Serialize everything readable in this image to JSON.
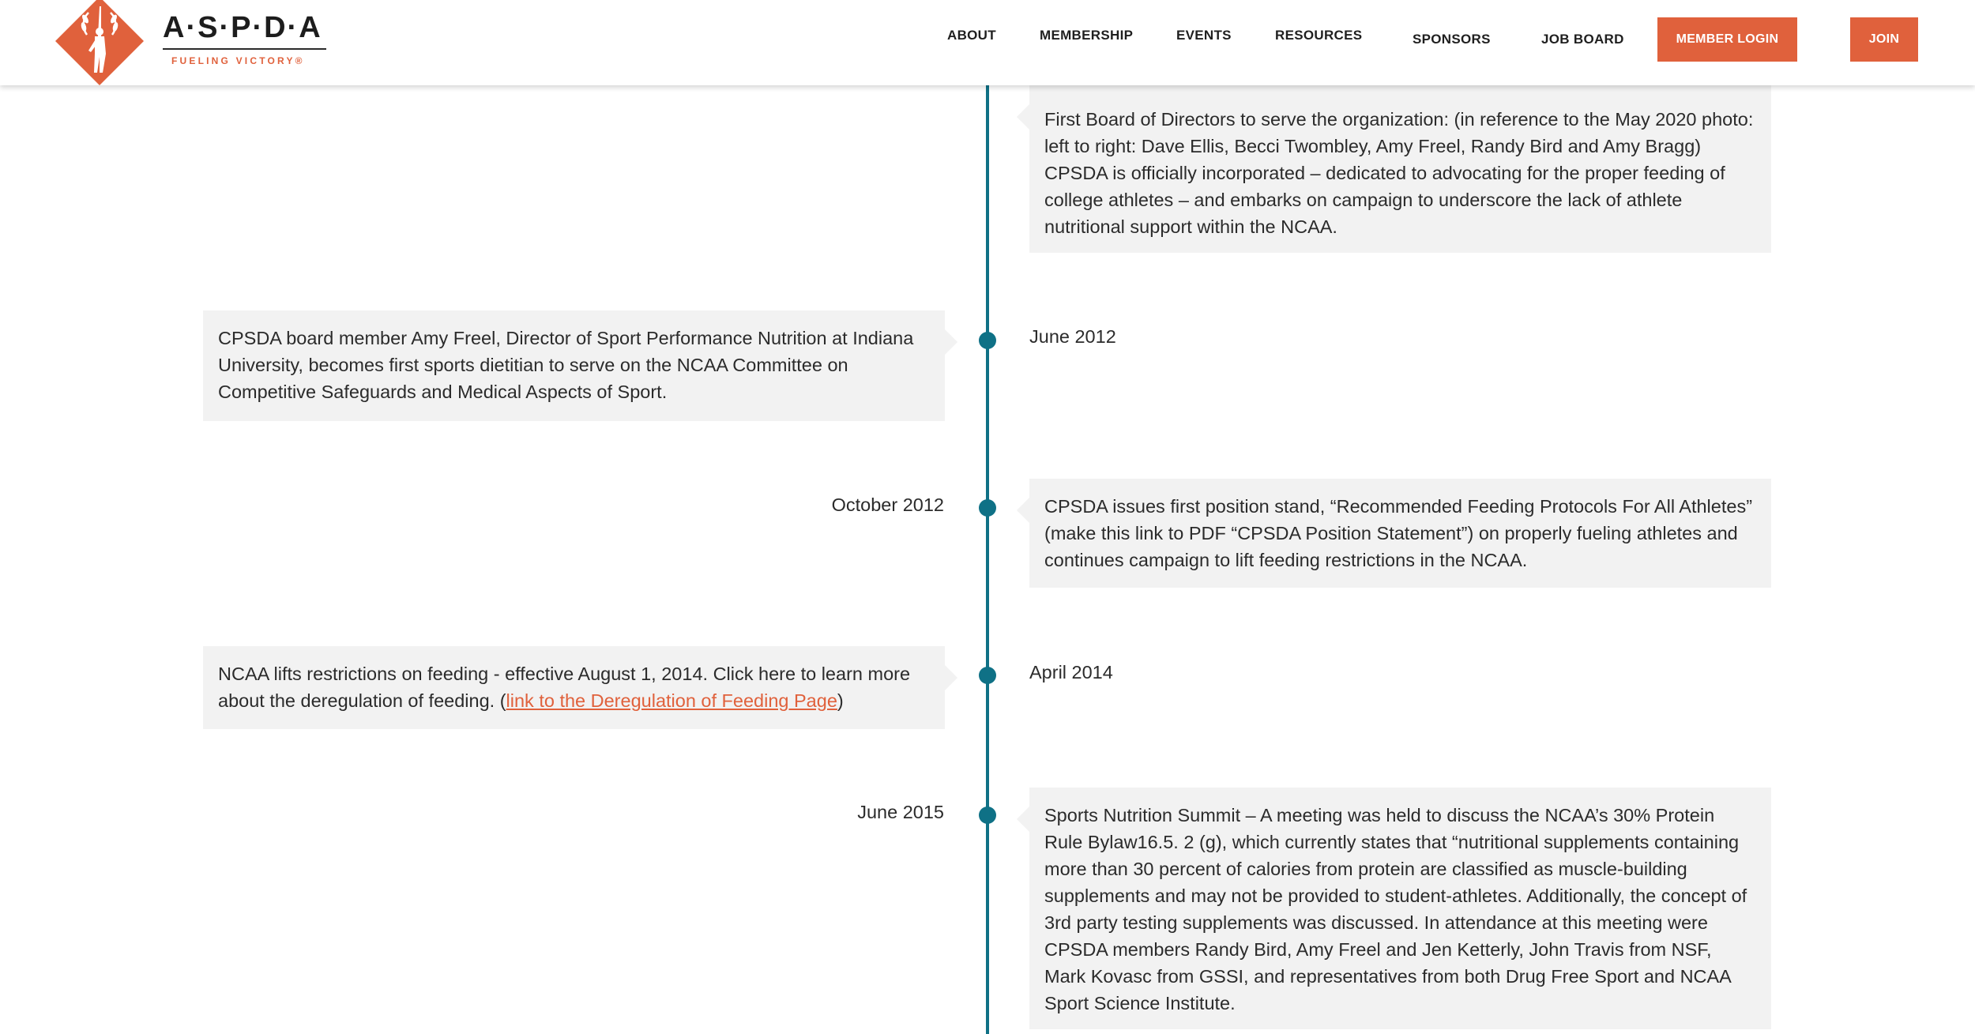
{
  "brand": {
    "name": "A·S·P·D·A",
    "tagline": "FUELING VICTORY®",
    "accent_color": "#e0613c",
    "timeline_color": "#0f7186"
  },
  "nav": {
    "about": "ABOUT",
    "membership": "MEMBERSHIP",
    "events": "EVENTS",
    "resources": "RESOURCES",
    "sponsors": "SPONSORS",
    "job_board": "JOB BOARD",
    "member_login": "MEMBER LOGIN",
    "join": "JOIN"
  },
  "timeline": {
    "entry0": {
      "text": "First Board of Directors to serve the organization: (in reference to the May 2020 photo: left to right: Dave Ellis, Becci Twombley, Amy Freel, Randy Bird and Amy Bragg) CPSDA is officially incorporated – dedicated to advocating for the proper feeding of college athletes – and embarks on campaign to underscore the lack of athlete nutritional support within the NCAA."
    },
    "entry1": {
      "date": "June 2012",
      "text": "CPSDA board member Amy Freel, Director of Sport Performance Nutrition at Indiana University, becomes first sports dietitian to serve on the NCAA Committee on Competitive Safeguards and Medical Aspects of Sport."
    },
    "entry2": {
      "date": "October 2012",
      "text": "CPSDA issues first position stand, “Recommended Feeding Protocols For All Athletes” (make this link to PDF “CPSDA Position Statement”) on properly fueling athletes and continues campaign to lift feeding restrictions in the NCAA."
    },
    "entry3": {
      "date": "April 2014",
      "text": "NCAA lifts restrictions on feeding - effective August 1, 2014. Click here to learn more about the deregulation of feeding. (",
      "link": "link to the Deregulation of Feeding Page",
      "text_after": ")"
    },
    "entry4": {
      "date": "June 2015",
      "text": "Sports Nutrition Summit – A meeting was held to discuss the NCAA’s 30% Protein Rule Bylaw16.5. 2 (g), which currently states that “nutritional supplements containing more than 30 percent of calories from protein are classified as muscle-building supplements and may not be provided to student-athletes.  Additionally, the concept of 3rd party testing supplements was discussed. In attendance at this meeting were CPSDA members Randy Bird, Amy Freel and Jen Ketterly, John Travis from NSF, Mark Kovasc from GSSI, and representatives from both Drug Free Sport and NCAA Sport Science Institute."
    }
  }
}
